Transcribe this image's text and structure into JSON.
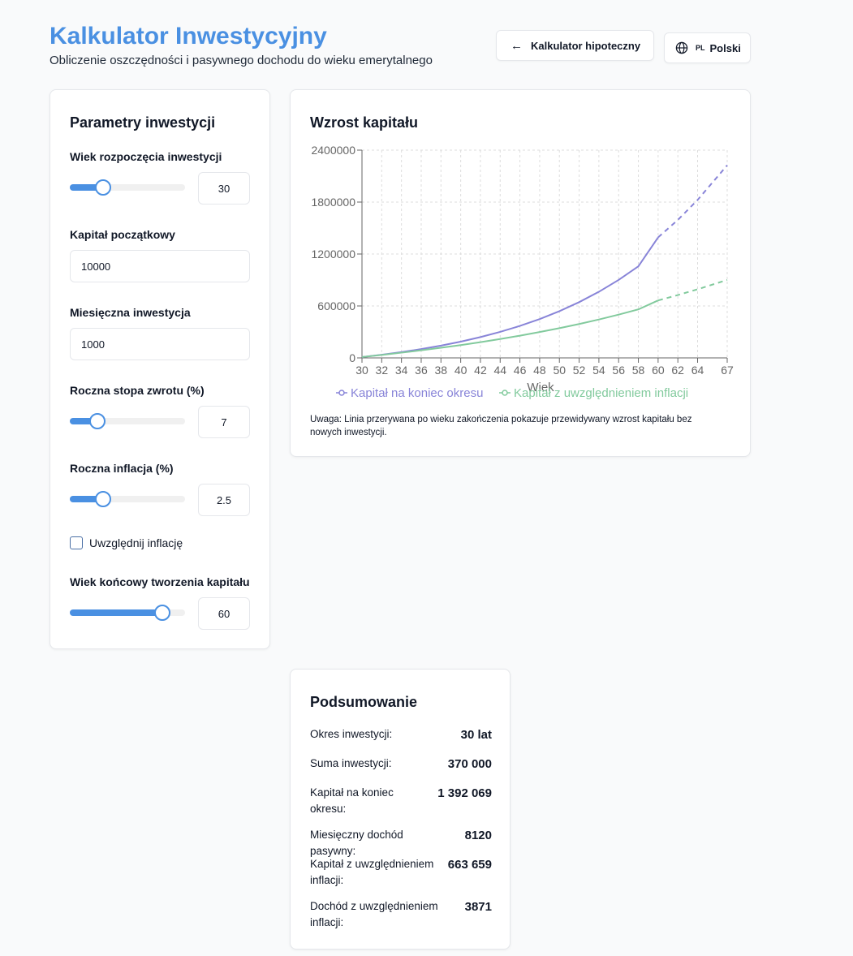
{
  "header": {
    "title": "Kalkulator Inwestycyjny",
    "subtitle": "Obliczenie oszczędności i pasywnego dochodu do wieku emerytalnego",
    "mortgage_button": "Kalkulator hipoteczny",
    "mortgage_icon": "arrow-left-icon",
    "language_icon": "globe-icon",
    "language_code": "PL",
    "language_label": "Polski"
  },
  "colors": {
    "accent": "#4a90e2",
    "series_nominal": "#8884d8",
    "series_real": "#82ca9d"
  },
  "params": {
    "title": "Parametry inwestycji",
    "start_age_label": "Wiek rozpoczęcia inwestycji",
    "start_age_value": "30",
    "start_age_slider_fraction": 0.29,
    "initial_capital_label": "Kapitał początkowy",
    "initial_capital_value": "10000",
    "monthly_label": "Miesięczna inwestycja",
    "monthly_value": "1000",
    "return_label": "Roczna stopa zwrotu (%)",
    "return_value": "7",
    "return_slider_fraction": 0.24,
    "inflation_label": "Roczna inflacja (%)",
    "inflation_value": "2.5",
    "inflation_slider_fraction": 0.29,
    "include_inflation_label": "Uwzględnij inflację",
    "include_inflation_checked": false,
    "end_age_label": "Wiek końcowy tworzenia kapitału",
    "end_age_value": "60",
    "end_age_slider_fraction": 0.8
  },
  "chart": {
    "title": "Wzrost kapitału",
    "note": "Uwaga: Linia przerywana po wieku zakończenia pokazuje przewidywany wzrost kapitału bez nowych inwestycji."
  },
  "chart_data": {
    "type": "line",
    "xlabel": "Wiek",
    "ylabel": "",
    "xlim": [
      30,
      67
    ],
    "ylim": [
      0,
      2400000
    ],
    "x_ticks": [
      30,
      32,
      34,
      36,
      38,
      40,
      42,
      44,
      46,
      48,
      50,
      52,
      54,
      56,
      58,
      60,
      62,
      64,
      67
    ],
    "y_ticks": [
      0,
      600000,
      1200000,
      1800000,
      2400000
    ],
    "grid": true,
    "legend_position": "bottom",
    "end_age": 60,
    "series": [
      {
        "name": "Kapitał na koniec okresu",
        "color": "#8884d8",
        "solid": {
          "x": [
            30,
            32,
            34,
            36,
            38,
            40,
            42,
            44,
            46,
            48,
            50,
            52,
            54,
            56,
            58,
            60
          ],
          "y": [
            10000,
            36300,
            66800,
            101600,
            141600,
            187400,
            240000,
            300300,
            369400,
            448700,
            539600,
            643900,
            763500,
            900700,
            1058000,
            1392069
          ]
        },
        "dashed": {
          "x": [
            60,
            62,
            64,
            67
          ],
          "y": [
            1392069,
            1593800,
            1824700,
            2225200
          ]
        }
      },
      {
        "name": "Kapitał z uwzględnieniem inflacji",
        "color": "#82ca9d",
        "solid": {
          "x": [
            30,
            32,
            34,
            36,
            38,
            40,
            42,
            44,
            46,
            48,
            50,
            52,
            54,
            56,
            58,
            60
          ],
          "y": [
            10000,
            34500,
            60400,
            87800,
            117100,
            148100,
            181800,
            217800,
            256800,
            298400,
            343400,
            391700,
            443500,
            499800,
            560400,
            663659
          ]
        },
        "dashed": {
          "x": [
            60,
            62,
            64,
            67
          ],
          "y": [
            663659,
            725900,
            792300,
            900800
          ]
        }
      }
    ]
  },
  "summary": {
    "title": "Podsumowanie",
    "rows": [
      {
        "label": "Okres inwestycji:",
        "value": "30 lat"
      },
      {
        "label": "Suma inwestycji:",
        "value": "370 000"
      },
      {
        "label": "Kapitał na koniec okresu:",
        "value": "1 392 069"
      },
      {
        "label": "Miesięczny dochód pasywny:",
        "value": "8120"
      },
      {
        "label": "Kapitał z uwzględnieniem inflacji:",
        "value": "663 659"
      },
      {
        "label": "Dochód z uwzględnieniem inflacji:",
        "value": "3871"
      }
    ]
  }
}
